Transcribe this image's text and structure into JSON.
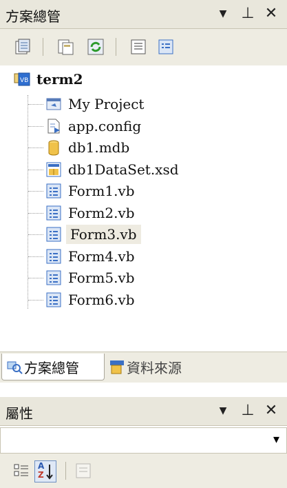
{
  "solution_explorer": {
    "title": "方案總管",
    "dropdown_glyph": "▼",
    "pin_glyph": "⊥",
    "close_glyph": "✕",
    "toolbar": [
      "properties-icon",
      "show-all-files-icon",
      "refresh-icon",
      "view-code-icon",
      "view-designer-icon"
    ],
    "tree": {
      "root": {
        "label": "term2",
        "icon": "vb-project-icon"
      },
      "items": [
        {
          "label": "My Project",
          "icon": "my-project-icon"
        },
        {
          "label": "app.config",
          "icon": "config-file-icon"
        },
        {
          "label": "db1.mdb",
          "icon": "database-icon"
        },
        {
          "label": "db1DataSet.xsd",
          "icon": "dataset-icon"
        },
        {
          "label": "Form1.vb",
          "icon": "form-icon"
        },
        {
          "label": "Form2.vb",
          "icon": "form-icon"
        },
        {
          "label": "Form3.vb",
          "icon": "form-icon",
          "selected": true
        },
        {
          "label": "Form4.vb",
          "icon": "form-icon"
        },
        {
          "label": "Form5.vb",
          "icon": "form-icon"
        },
        {
          "label": "Form6.vb",
          "icon": "form-icon"
        }
      ]
    }
  },
  "tabs": [
    {
      "label": "方案總管",
      "icon": "solution-explorer-icon",
      "active": true
    },
    {
      "label": "資料來源",
      "icon": "data-sources-icon",
      "active": false
    }
  ],
  "properties": {
    "title": "屬性",
    "dropdown_glyph": "▼",
    "pin_glyph": "⊥",
    "close_glyph": "✕",
    "combo_value": "",
    "combo_arrow": "▾",
    "az_top": "A",
    "az_bottom": "Z"
  },
  "colors": {
    "header_bg": "#e9e7dc",
    "toolbar_bg": "#eeece2",
    "selection": "#eeebe1",
    "form_icon": "#3a6fc4"
  }
}
